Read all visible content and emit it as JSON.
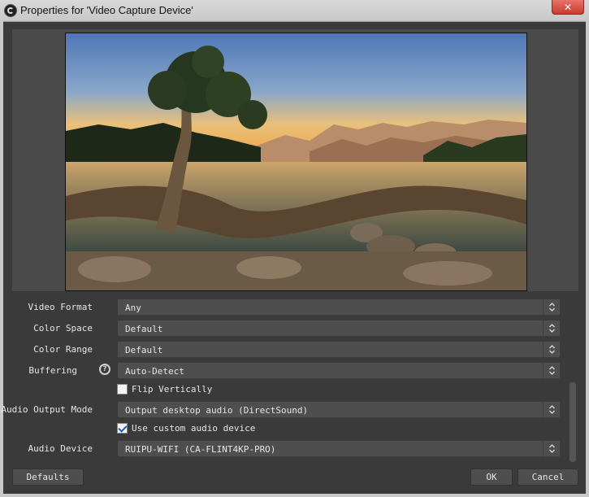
{
  "window": {
    "title": "Properties for 'Video Capture Device'",
    "close_label": "✕"
  },
  "properties": {
    "video_format": {
      "label": "Video Format",
      "value": "Any"
    },
    "color_space": {
      "label": "Color Space",
      "value": "Default"
    },
    "color_range": {
      "label": "Color Range",
      "value": "Default"
    },
    "buffering": {
      "label": "Buffering",
      "value": "Auto-Detect",
      "help_icon": "?"
    },
    "flip_vertically": {
      "label": "Flip Vertically",
      "checked": false
    },
    "audio_output_mode": {
      "label": "Audio Output Mode",
      "value": "Output desktop audio (DirectSound)"
    },
    "use_custom_audio": {
      "label": "Use custom audio device",
      "checked": true
    },
    "audio_device": {
      "label": "Audio Device",
      "value": "RUIPU-WIFI (CA-FLINT4KP-PRO)"
    }
  },
  "buttons": {
    "defaults": "Defaults",
    "ok": "OK",
    "cancel": "Cancel"
  }
}
